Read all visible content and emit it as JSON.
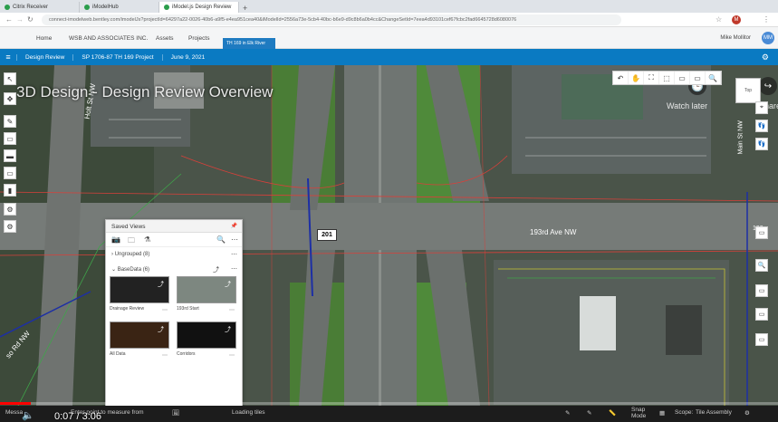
{
  "browser": {
    "tabs": [
      {
        "label": "Citrix Receiver",
        "color": "#2a9d4b"
      },
      {
        "label": "iModelHub",
        "color": "#2a9d4b"
      },
      {
        "label": "iModel.js Design Review",
        "color": "#2a9d4b",
        "active": true
      }
    ],
    "new_tab": "+",
    "url": "connect-imodelweb.bentley.com/imodelJs?projectId=64297a22-0026-40b6-a9f5-e4ea951cea40&iModelId=2556a73e-5cb4-40bc-b6e9-d9c8b6a0b4cc&ChangeSetId=7eea4d93101cef67fcbc2fad6645728d6080076"
  },
  "bim_nav": {
    "items": [
      "Home",
      "WSB AND ASSOCIATES INC.",
      "Assets",
      "Projects"
    ],
    "project_tab": "TH 169 in Elk River",
    "user": "Mike Mollitor",
    "avatar": "MM"
  },
  "breadcrumb": {
    "menu_icon": "≡",
    "items": [
      "Design Review",
      "SP 1706-87 TH 169 Project",
      "June 9, 2021"
    ],
    "gear_icon": "⚙"
  },
  "video_overlay": {
    "title": "3D Design - Design Review Overview",
    "watch_later": "Watch later",
    "share": "Share",
    "time": "0:07 / 3:06",
    "progress": 0.04
  },
  "map": {
    "labels": {
      "holt": "Holt St NW",
      "street193": "193rd Ave NW",
      "road_nw": "so Rd NW",
      "route_shield": "201",
      "right_street": "Main St NW",
      "right_edge": "193r"
    }
  },
  "toolbar": {
    "top": [
      "↶",
      "✋",
      "⛶",
      "⬚",
      "▭",
      "▭",
      "🔍"
    ],
    "cube_label": "Top",
    "left": [
      "↖",
      "✥",
      "✎",
      "▭",
      "▬",
      "▭",
      "▮",
      "⚙",
      "⚙"
    ],
    "right": [
      "⌖",
      "👣",
      "👣",
      "▭",
      "🔍",
      "▭",
      "▭",
      "▭"
    ]
  },
  "saved_views": {
    "title": "Saved Views",
    "groups": [
      {
        "name": "Ungrouped (8)",
        "expanded": false
      },
      {
        "name": "BaseData (6)",
        "expanded": true
      }
    ],
    "views": [
      {
        "caption": "Drainage Review",
        "bg": "#222"
      },
      {
        "caption": "193rd Start",
        "bg": "#7d8780"
      },
      {
        "caption": "All Data",
        "bg": "#3a2414"
      },
      {
        "caption": "Corridors",
        "bg": "#111"
      }
    ]
  },
  "status": {
    "message_label": "Messa",
    "prompt": "Enter point to measure from",
    "loading": "Loading tiles",
    "snap_mode": "Snap Mode",
    "scope": "Scope:",
    "scope_value": "Tile Assembly"
  }
}
